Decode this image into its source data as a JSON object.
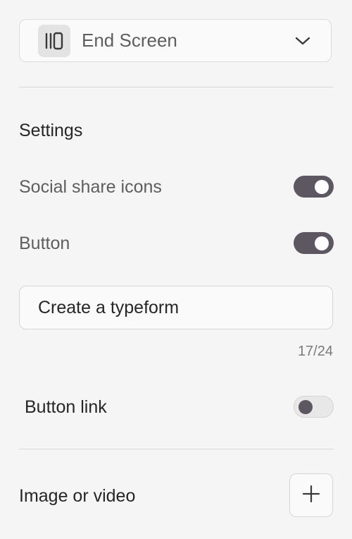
{
  "block_type": {
    "label": "End Screen",
    "icon": "end-screen-icon"
  },
  "settings": {
    "title": "Settings",
    "social_share": {
      "label": "Social share icons",
      "enabled": true
    },
    "button": {
      "label": "Button",
      "enabled": true
    },
    "button_text": {
      "value": "Create a typeform",
      "counter": "17/24"
    },
    "button_link": {
      "label": "Button link",
      "enabled": false
    }
  },
  "media": {
    "title": "Image or video",
    "add_icon": "plus-icon"
  },
  "colors": {
    "toggle_on": "#5d5761",
    "background": "#f5f5f5"
  }
}
